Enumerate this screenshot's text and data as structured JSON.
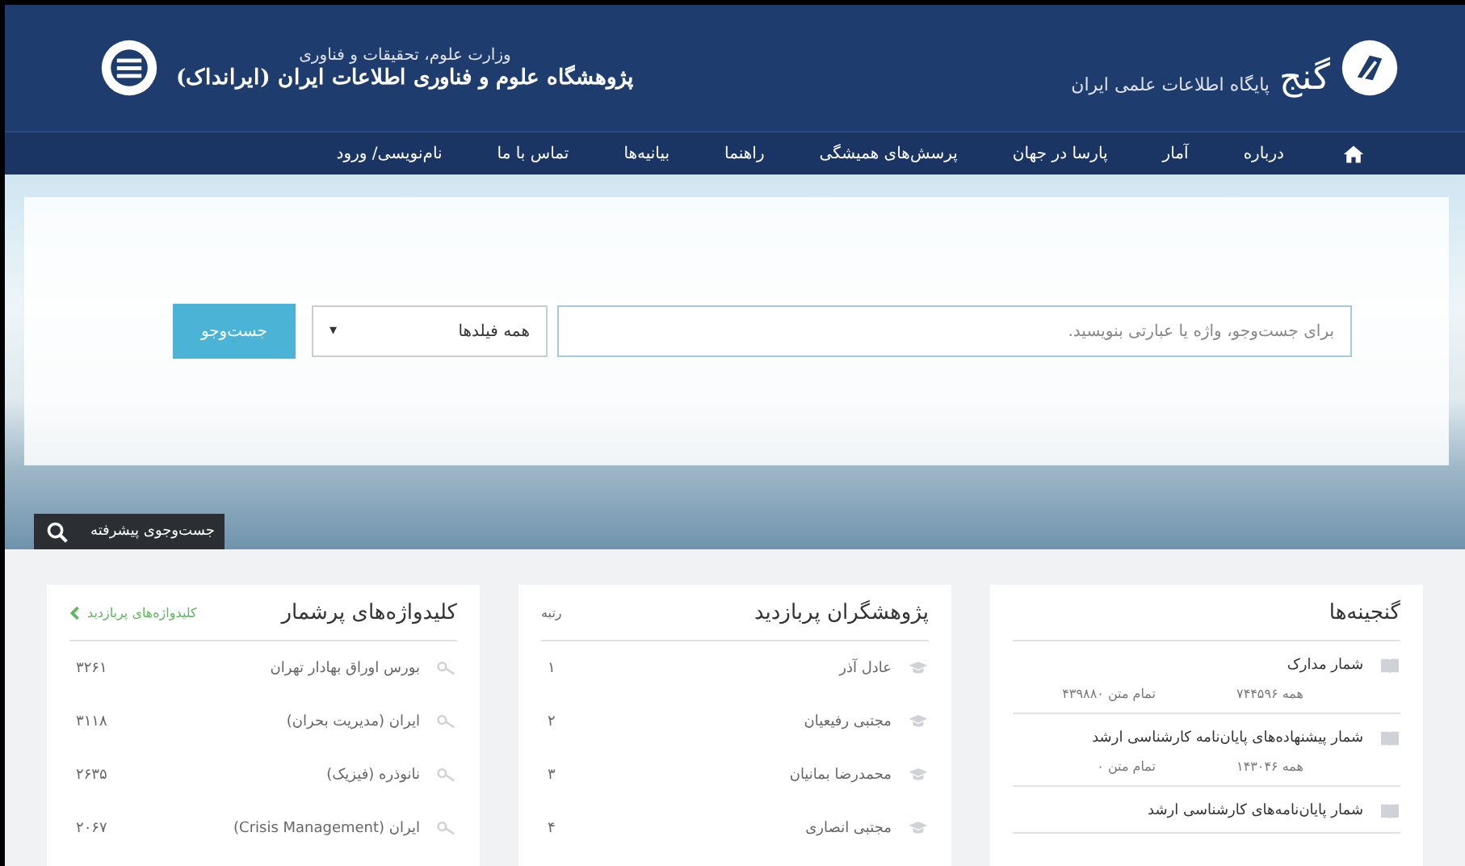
{
  "header": {
    "brand": "گنج",
    "tagline": "پایگاه اطلاعات علمی ایران",
    "ministry": "وزارت علوم، تحقیقات و فناوری",
    "institute": "پژوهشگاه علوم و فناوری اطلاعات ایران (ایرانداک)"
  },
  "nav": [
    "درباره",
    "آمار",
    "پارسا در جهان",
    "پرسش‌های همیشگی",
    "راهنما",
    "بیانیه‌ها",
    "تماس با ما",
    "نام‌نویسی/ ورود"
  ],
  "search": {
    "placeholder": "برای جست‌وجو، واژه یا عبارتی بنویسید.",
    "field_select": "همه فیلدها",
    "select_caret": "▾",
    "button": "جست‌وجو",
    "advanced": "جست‌وجوی پیشرفته"
  },
  "collections": {
    "title": "گنجینه‌ها",
    "items": [
      {
        "title": "شمار مدارک",
        "all": "همه ۷۴۴۵۹۶",
        "fulltext": "تمام متن ۴۳۹۸۸۰"
      },
      {
        "title": "شمار پیشنهاده‌های پایان‌نامه کارشناسی ارشد",
        "all": "همه ۱۴۳۰۴۶",
        "fulltext": "تمام متن ۰"
      },
      {
        "title": "شمار پایان‌نامه‌های کارشناسی ارشد"
      }
    ]
  },
  "researchers": {
    "title": "پژوهشگران پربازدید",
    "column": "رتبه",
    "rows": [
      {
        "name": "عادل آذر",
        "rank": "۱"
      },
      {
        "name": "مجتبی رفیعیان",
        "rank": "۲"
      },
      {
        "name": "محمدرضا بمانیان",
        "rank": "۳"
      },
      {
        "name": "مجتبی انصاری",
        "rank": "۴"
      }
    ]
  },
  "keywords": {
    "title": "کلیدواژه‌های پرشمار",
    "link": "کلیدواژه‌های پربازدید",
    "rows": [
      {
        "term": "بورس اوراق بهادار تهران",
        "count": "۳۲۶۱"
      },
      {
        "term": "ایران (مدیریت بحران)",
        "count": "۳۱۱۸"
      },
      {
        "term": "نانوذره (فیزیک)",
        "count": "۲۶۳۵"
      },
      {
        "term": "ایران (Crisis Management)",
        "count": "۲۰۶۷"
      }
    ]
  }
}
